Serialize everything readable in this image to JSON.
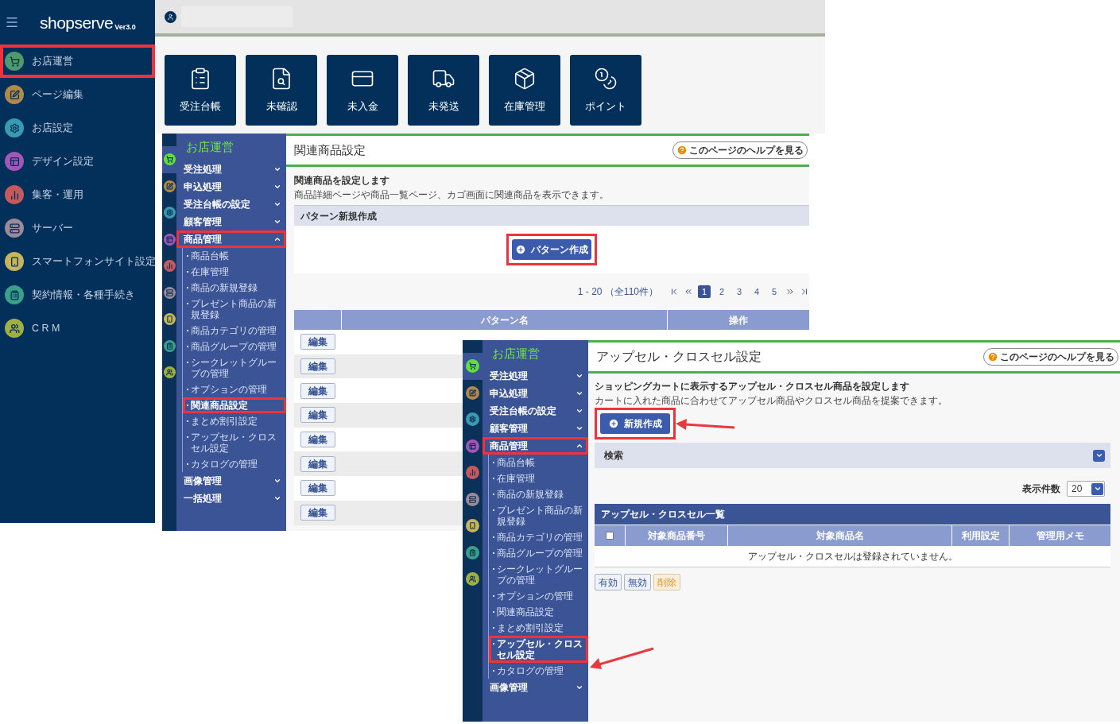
{
  "main_sidebar": {
    "logo": "shopserve",
    "version": "Ver3.0",
    "items": [
      {
        "label": "お店運営",
        "highlighted": true,
        "color": "#4e9a6e"
      },
      {
        "label": "ページ編集",
        "highlighted": false,
        "color": "#b08a4a"
      },
      {
        "label": "お店設定",
        "highlighted": false,
        "color": "#3a9bb0"
      },
      {
        "label": "デザイン設定",
        "highlighted": false,
        "color": "#a456b8"
      },
      {
        "label": "集客・運用",
        "highlighted": false,
        "color": "#c45a5e"
      },
      {
        "label": "サーバー",
        "highlighted": false,
        "color": "#9a8a9a"
      },
      {
        "label": "スマートフォンサイト設定",
        "highlighted": false,
        "color": "#c8b45a"
      },
      {
        "label": "契約情報・各種手続き",
        "highlighted": false,
        "color": "#3aa08a"
      },
      {
        "label": "C R M",
        "highlighted": false,
        "color": "#a0b040"
      }
    ]
  },
  "shortcuts": [
    {
      "label": "受注台帳"
    },
    {
      "label": "未確認"
    },
    {
      "label": "未入金"
    },
    {
      "label": "未発送"
    },
    {
      "label": "在庫管理"
    },
    {
      "label": "ポイント"
    }
  ],
  "related_products_window": {
    "rail": [
      {
        "color": "#5ee23a",
        "selected": true
      },
      {
        "color": "#b08a4a",
        "selected": false
      },
      {
        "color": "#3a9bb0",
        "selected": false
      },
      {
        "color": "#a456b8",
        "selected": false
      },
      {
        "color": "#c45a5e",
        "selected": false
      },
      {
        "color": "#9a8a9a",
        "selected": false
      },
      {
        "color": "#c8b45a",
        "selected": false
      },
      {
        "color": "#3aa08a",
        "selected": false
      },
      {
        "color": "#a0b040",
        "selected": false
      }
    ],
    "nav": {
      "title": "お店運営",
      "items": [
        {
          "label": "受注処理",
          "expanded": false,
          "highlighted": false
        },
        {
          "label": "申込処理",
          "expanded": false,
          "highlighted": false
        },
        {
          "label": "受注台帳の設定",
          "expanded": false,
          "highlighted": false
        },
        {
          "label": "顧客管理",
          "expanded": false,
          "highlighted": false
        },
        {
          "label": "商品管理",
          "expanded": true,
          "highlighted": true,
          "children": [
            {
              "label": "商品台帳",
              "selected": false,
              "highlighted": false
            },
            {
              "label": "在庫管理",
              "selected": false,
              "highlighted": false
            },
            {
              "label": "商品の新規登録",
              "selected": false,
              "highlighted": false
            },
            {
              "label": "プレゼント商品の新規登録",
              "selected": false,
              "highlighted": false
            },
            {
              "label": "商品カテゴリの管理",
              "selected": false,
              "highlighted": false
            },
            {
              "label": "商品グループの管理",
              "selected": false,
              "highlighted": false
            },
            {
              "label": "シークレットグループの管理",
              "selected": false,
              "highlighted": false
            },
            {
              "label": "オプションの管理",
              "selected": false,
              "highlighted": false
            },
            {
              "label": "関連商品設定",
              "selected": true,
              "highlighted": true
            },
            {
              "label": "まとめ割引設定",
              "selected": false,
              "highlighted": false
            },
            {
              "label": "アップセル・クロスセル設定",
              "selected": false,
              "highlighted": false
            },
            {
              "label": "カタログの管理",
              "selected": false,
              "highlighted": false
            }
          ]
        },
        {
          "label": "画像管理",
          "expanded": false,
          "highlighted": false
        },
        {
          "label": "一括処理",
          "expanded": false,
          "highlighted": false
        }
      ]
    },
    "title": "関連商品設定",
    "help": "このページのヘルプを見る",
    "heading": "関連商品を設定します",
    "description": "商品詳細ページや商品一覧ページ、カゴ画面に関連商品を表示できます。",
    "section": "パターン新規作成",
    "create_button": {
      "label": "パターン作成",
      "highlighted": true
    },
    "pagination": {
      "range": "1 - 20 （全110件）",
      "pages": [
        {
          "label": "1",
          "selected": true
        },
        {
          "label": "2",
          "selected": false
        },
        {
          "label": "3",
          "selected": false
        },
        {
          "label": "4",
          "selected": false
        },
        {
          "label": "5",
          "selected": false
        }
      ]
    },
    "table": {
      "columns": [
        "パターン名",
        "操作"
      ],
      "rows": [
        {
          "edit": "編集"
        },
        {
          "edit": "編集"
        },
        {
          "edit": "編集"
        },
        {
          "edit": "編集"
        },
        {
          "edit": "編集"
        },
        {
          "edit": "編集"
        },
        {
          "edit": "編集"
        },
        {
          "edit": "編集"
        }
      ]
    }
  },
  "upsell_window": {
    "rail": [
      {
        "color": "#5ee23a",
        "selected": true
      },
      {
        "color": "#b08a4a",
        "selected": false
      },
      {
        "color": "#3a9bb0",
        "selected": false
      },
      {
        "color": "#a456b8",
        "selected": false
      },
      {
        "color": "#c45a5e",
        "selected": false
      },
      {
        "color": "#9a8a9a",
        "selected": false
      },
      {
        "color": "#c8b45a",
        "selected": false
      },
      {
        "color": "#3aa08a",
        "selected": false
      },
      {
        "color": "#a0b040",
        "selected": false
      }
    ],
    "nav": {
      "title": "お店運営",
      "items": [
        {
          "label": "受注処理",
          "expanded": false,
          "highlighted": false
        },
        {
          "label": "申込処理",
          "expanded": false,
          "highlighted": false
        },
        {
          "label": "受注台帳の設定",
          "expanded": false,
          "highlighted": false
        },
        {
          "label": "顧客管理",
          "expanded": false,
          "highlighted": false
        },
        {
          "label": "商品管理",
          "expanded": true,
          "highlighted": true,
          "children": [
            {
              "label": "商品台帳",
              "selected": false,
              "highlighted": false
            },
            {
              "label": "在庫管理",
              "selected": false,
              "highlighted": false
            },
            {
              "label": "商品の新規登録",
              "selected": false,
              "highlighted": false
            },
            {
              "label": "プレゼント商品の新規登録",
              "selected": false,
              "highlighted": false
            },
            {
              "label": "商品カテゴリの管理",
              "selected": false,
              "highlighted": false
            },
            {
              "label": "商品グループの管理",
              "selected": false,
              "highlighted": false
            },
            {
              "label": "シークレットグループの管理",
              "selected": false,
              "highlighted": false
            },
            {
              "label": "オプションの管理",
              "selected": false,
              "highlighted": false
            },
            {
              "label": "関連商品設定",
              "selected": false,
              "highlighted": false
            },
            {
              "label": "まとめ割引設定",
              "selected": false,
              "highlighted": false
            },
            {
              "label": "アップセル・クロスセル設定",
              "selected": true,
              "highlighted": true
            },
            {
              "label": "カタログの管理",
              "selected": false,
              "highlighted": false
            }
          ]
        },
        {
          "label": "画像管理",
          "expanded": false,
          "highlighted": false
        }
      ]
    },
    "title": "アップセル・クロスセル設定",
    "help": "このページのヘルプを見る",
    "heading": "ショッピングカートに表示するアップセル・クロスセル商品を設定します",
    "description": "カートに入れた商品に合わせてアップセル商品やクロスセル商品を提案できます。",
    "create_button": {
      "label": "新規作成",
      "highlighted": true
    },
    "search": {
      "label": "検索",
      "expanded": false
    },
    "page_size": {
      "label": "表示件数",
      "value": "20"
    },
    "table": {
      "title": "アップセル・クロスセル一覧",
      "select_all": {
        "checked": false
      },
      "columns": [
        "対象商品番号",
        "対象商品名",
        "利用設定",
        "管理用メモ"
      ],
      "empty_message": "アップセル・クロスセルは登録されていません。"
    },
    "actions": [
      {
        "label": "有効",
        "kind": "normal"
      },
      {
        "label": "無効",
        "kind": "normal"
      },
      {
        "label": "削除",
        "kind": "danger"
      }
    ]
  }
}
